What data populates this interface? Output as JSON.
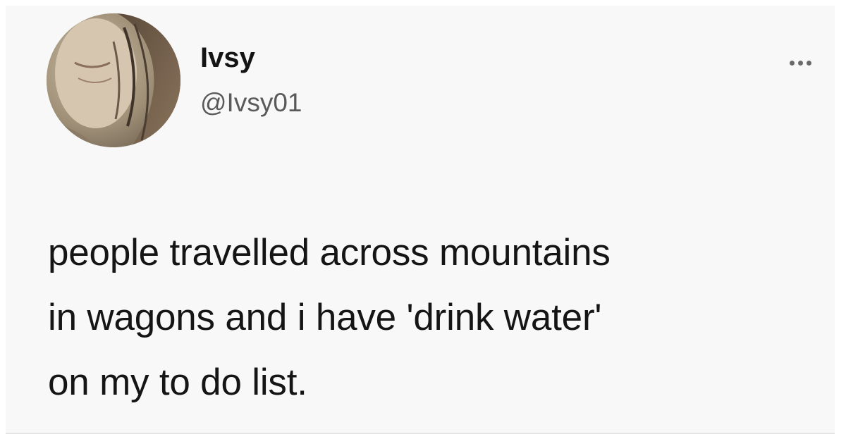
{
  "tweet": {
    "author": {
      "display_name": "Ivsy",
      "handle": "@Ivsy01",
      "avatar_icon": "profile-photo"
    },
    "more_icon": "more-options-icon",
    "text_lines": [
      "people travelled across mountains",
      "in wagons and i have 'drink water'",
      "on my to do list."
    ]
  },
  "colors": {
    "background": "#f8f8f8",
    "text": "#151515",
    "handle": "#5a5a5a"
  }
}
